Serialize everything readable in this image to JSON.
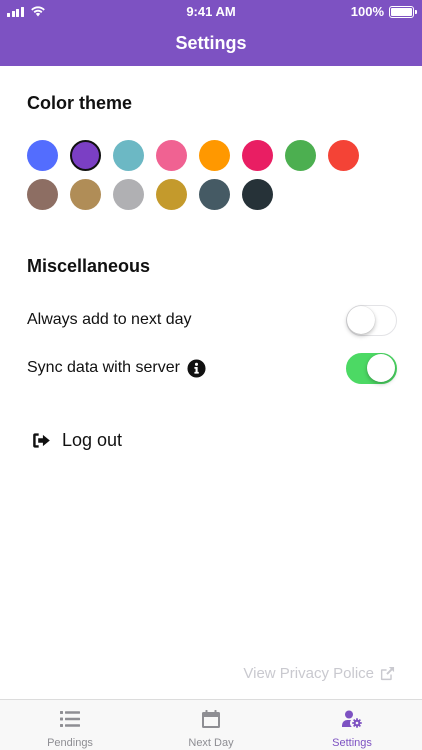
{
  "status_bar": {
    "time": "9:41 AM",
    "battery": "100%",
    "battery_level": 1.0
  },
  "header": {
    "title": "Settings",
    "background": "#7d52c2"
  },
  "color_theme": {
    "title": "Color theme",
    "selected_index": 1,
    "swatches": [
      "#536dfe",
      "#7b3fc4",
      "#6cb8c4",
      "#f06292",
      "#ff9800",
      "#e91e63",
      "#4caf50",
      "#f44336",
      "#8d6e63",
      "#b08d57",
      "#b0b0b3",
      "#c49a2c",
      "#455a64",
      "#263238"
    ]
  },
  "misc": {
    "title": "Miscellaneous",
    "always_add_label": "Always add to next day",
    "always_add_on": false,
    "sync_label": "Sync data with server",
    "sync_on": true
  },
  "logout": {
    "label": "Log out"
  },
  "privacy": {
    "label": "View Privacy Police"
  },
  "tabs": [
    {
      "label": "Pendings",
      "icon": "list-icon",
      "active": false
    },
    {
      "label": "Next Day",
      "icon": "calendar-icon",
      "active": false
    },
    {
      "label": "Settings",
      "icon": "user-cog-icon",
      "active": true
    }
  ],
  "colors": {
    "accent": "#7d52c2",
    "toggle_on": "#4cd964",
    "muted_text": "#c9c9cf",
    "tab_inactive": "#8e8e93"
  }
}
